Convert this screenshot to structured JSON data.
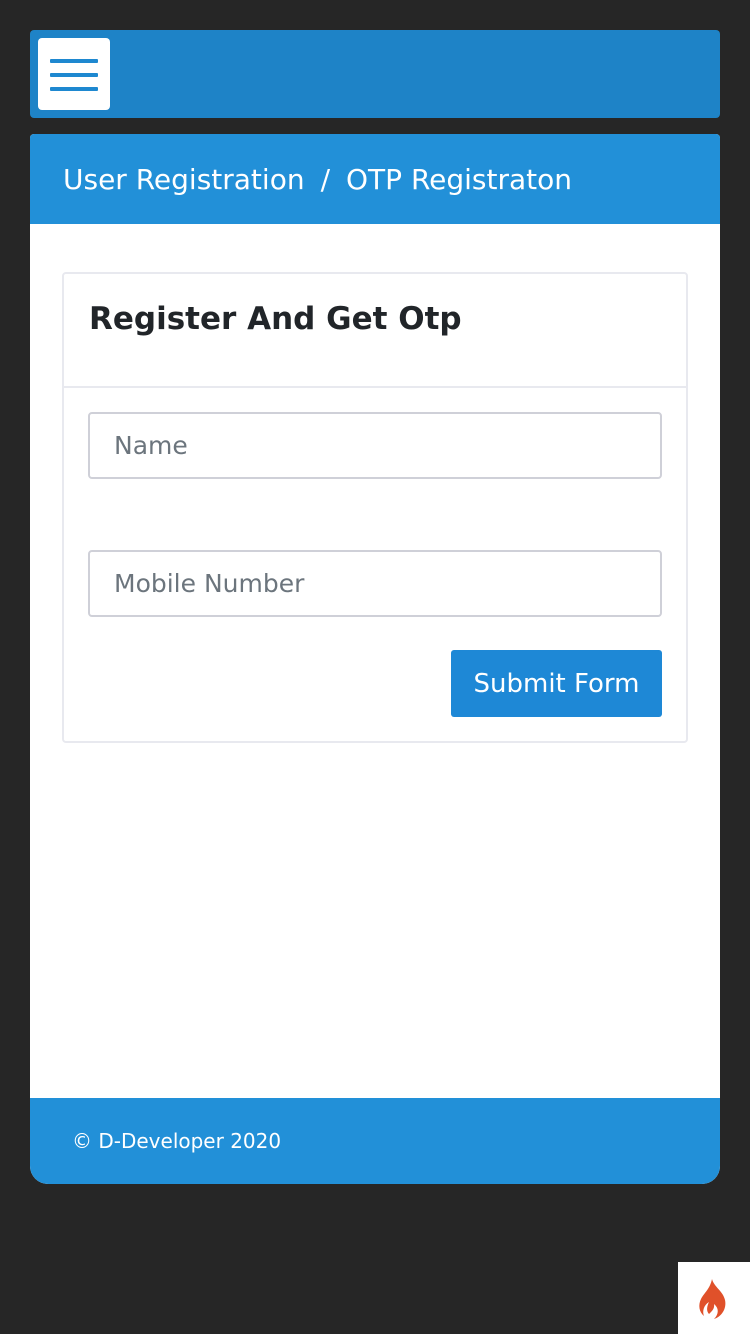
{
  "header": {
    "menu_icon": "hamburger-menu-icon",
    "accent_color": "#1e83c7"
  },
  "breadcrumb": {
    "parent": "User Registration",
    "separator": "/",
    "current": "OTP Registraton"
  },
  "form": {
    "title": "Register And Get Otp",
    "name_placeholder": "Name",
    "name_value": "",
    "mobile_placeholder": "Mobile Number",
    "mobile_value": "",
    "submit_label": "Submit Form"
  },
  "footer": {
    "text": "© D-Developer 2020"
  },
  "corner_badge": {
    "icon": "flame-icon",
    "color": "#e0512a"
  },
  "colors": {
    "page_background": "#262626",
    "primary": "#2290d8",
    "button": "#1e88d6"
  }
}
